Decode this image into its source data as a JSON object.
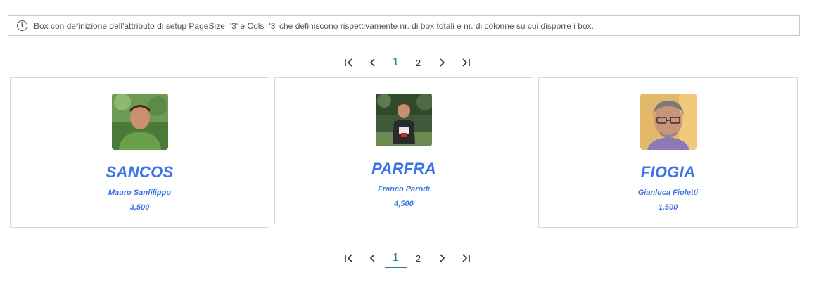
{
  "info": {
    "icon": "info-circle-icon",
    "text": "Box con definizione dell'attributo di setup PageSize='3' e Cols='3' che definiscono rispettivamente nr. di box totali e nr. di colonne su cui disporre i box."
  },
  "pager": {
    "first": "|<",
    "prev": "<",
    "pages": [
      "1",
      "2"
    ],
    "active_page": "1",
    "next": ">",
    "last": ">|",
    "accent": "#2a7d9a"
  },
  "cards": [
    {
      "code": "SANCOS",
      "name": "Mauro Sanfilippo",
      "value": "3,500",
      "avatar": "avatar-photo"
    },
    {
      "code": "PARFRA",
      "name": "Franco Parodi",
      "value": "4,500",
      "avatar": "avatar-photo"
    },
    {
      "code": "FIOGIA",
      "name": "Gianluca Fioletti",
      "value": "1,500",
      "avatar": "avatar-photo"
    }
  ],
  "colors": {
    "card_text": "#3b73e8",
    "border": "#d8d8d8"
  }
}
